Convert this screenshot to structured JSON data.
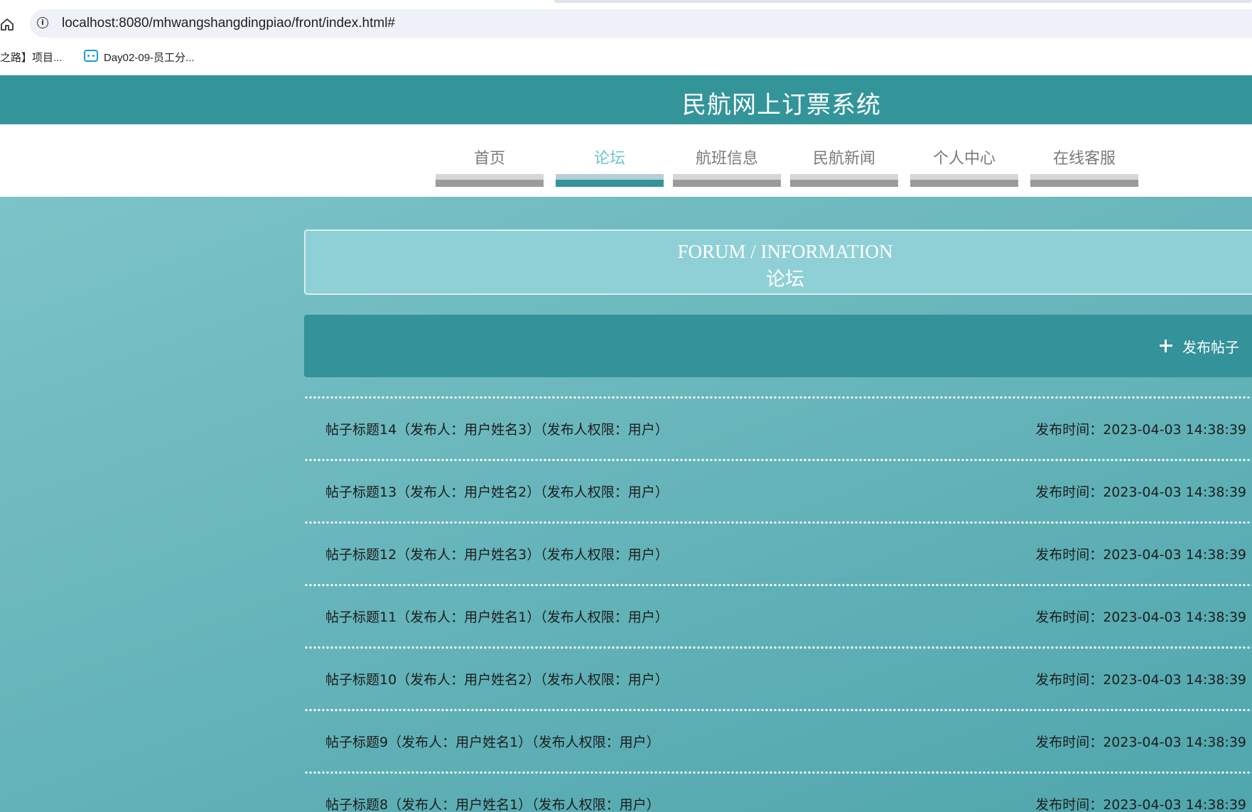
{
  "browser": {
    "url": "localhost:8080/mhwangshangdingpiao/front/index.html#",
    "bookmarks": [
      {
        "label": "之路】项目..."
      },
      {
        "label": "Day02-09-员工分..."
      }
    ]
  },
  "site": {
    "title": "民航网上订票系统"
  },
  "nav": {
    "items": [
      {
        "label": "首页"
      },
      {
        "label": "论坛"
      },
      {
        "label": "航班信息"
      },
      {
        "label": "民航新闻"
      },
      {
        "label": "个人中心"
      },
      {
        "label": "在线客服"
      }
    ],
    "active": "论坛"
  },
  "section": {
    "title_en": "FORUM / INFORMATION",
    "title_cn": "论坛",
    "publish_label": "发布帖子"
  },
  "posts": [
    {
      "title": "帖子标题14（发布人：用户姓名3）（发布人权限：用户）",
      "time": "发布时间：2023-04-03 14:38:39"
    },
    {
      "title": "帖子标题13（发布人：用户姓名2）（发布人权限：用户）",
      "time": "发布时间：2023-04-03 14:38:39"
    },
    {
      "title": "帖子标题12（发布人：用户姓名3）（发布人权限：用户）",
      "time": "发布时间：2023-04-03 14:38:39"
    },
    {
      "title": "帖子标题11（发布人：用户姓名1）（发布人权限：用户）",
      "time": "发布时间：2023-04-03 14:38:39"
    },
    {
      "title": "帖子标题10（发布人：用户姓名2）（发布人权限：用户）",
      "time": "发布时间：2023-04-03 14:38:39"
    },
    {
      "title": "帖子标题9（发布人：用户姓名1）（发布人权限：用户）",
      "time": "发布时间：2023-04-03 14:38:39"
    },
    {
      "title": "帖子标题8（发布人：用户姓名1）（发布人权限：用户）",
      "time": "发布时间：2023-04-03 14:38:39"
    }
  ],
  "colors": {
    "primary": "#33959a",
    "nav_active_text": "#6cc5d0",
    "title_box": "#8ed0d6"
  }
}
